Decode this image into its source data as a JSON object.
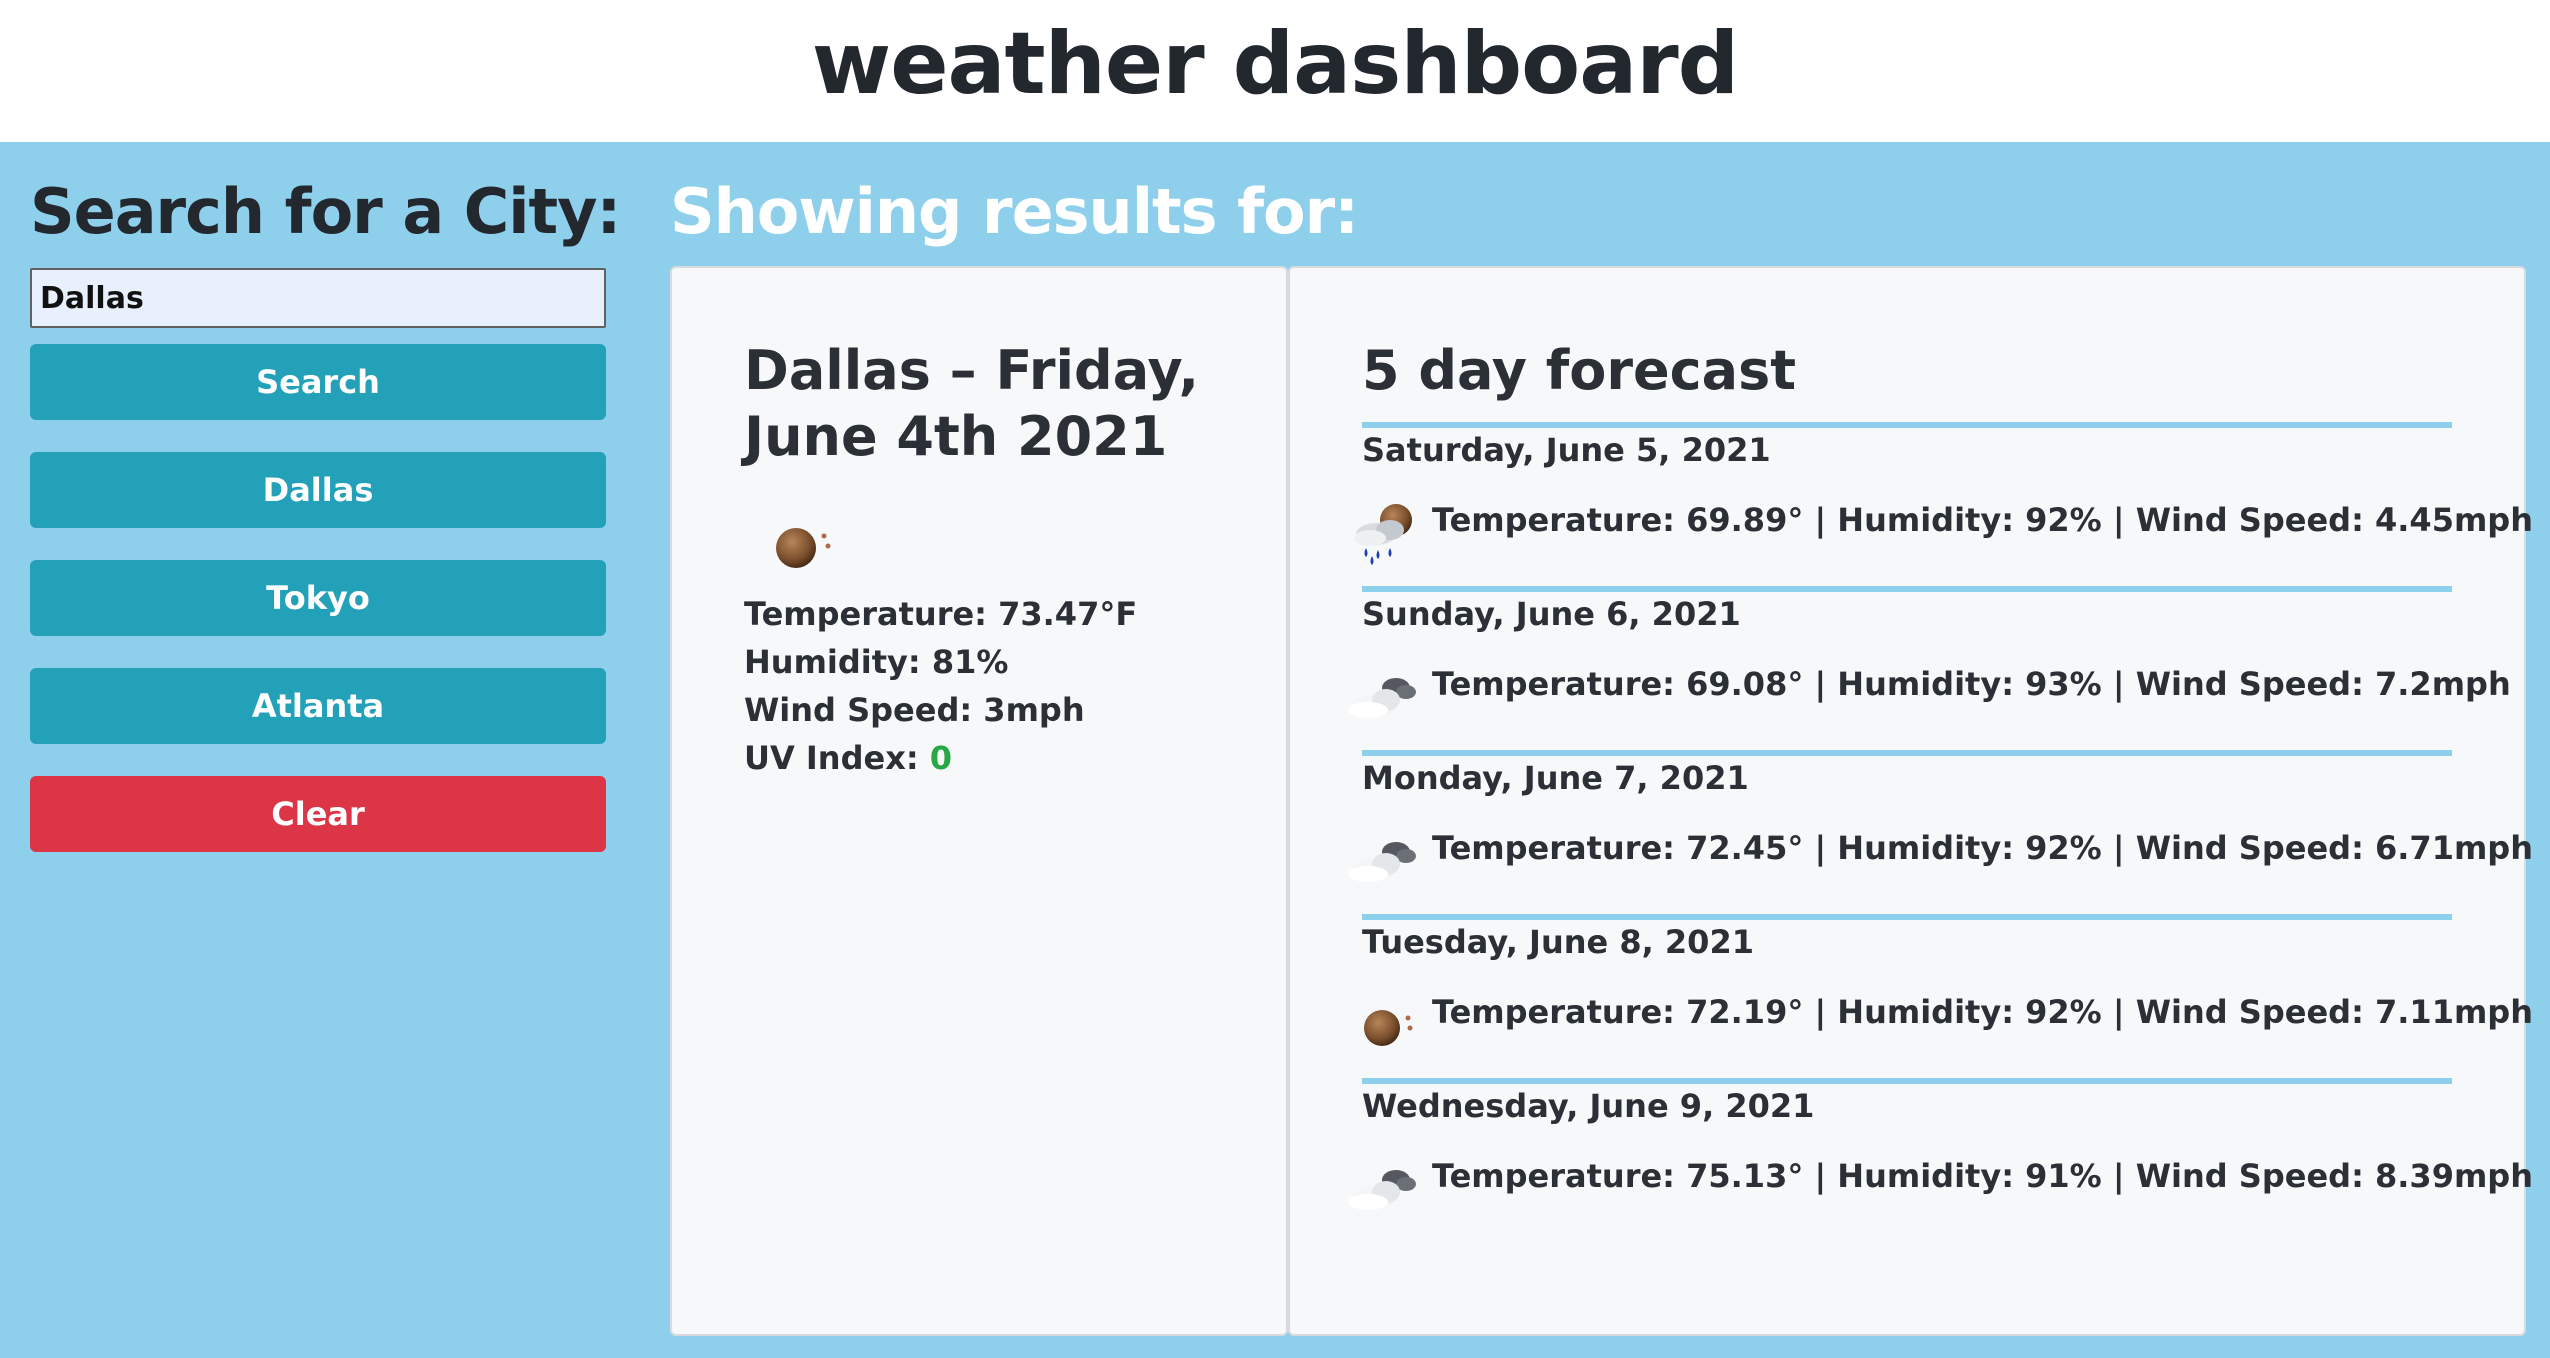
{
  "header": {
    "title": "weather dashboard"
  },
  "sidebar": {
    "heading": "Search for a City:",
    "search_value": "Dallas",
    "search_button": "Search",
    "history": [
      "Dallas",
      "Tokyo",
      "Atlanta"
    ],
    "clear_button": "Clear"
  },
  "results": {
    "heading": "Showing results for:"
  },
  "current": {
    "title": "Dallas – Friday, June 4th 2021",
    "icon": "sun-haze-icon",
    "temperature": "Temperature: 73.47°F",
    "humidity": "Humidity: 81%",
    "wind": "Wind Speed: 3mph",
    "uv_label": "UV Index: ",
    "uv_value": "0"
  },
  "forecast": {
    "title": "5 day forecast",
    "days": [
      {
        "date": "Saturday, June 5, 2021",
        "icon": "rain-cloud-icon",
        "info": "Temperature: 69.89° | Humidity: 92% | Wind Speed: 4.45mph"
      },
      {
        "date": "Sunday, June 6, 2021",
        "icon": "cloud-icon",
        "info": "Temperature: 69.08° | Humidity: 93% | Wind Speed: 7.2mph"
      },
      {
        "date": "Monday, June 7, 2021",
        "icon": "cloud-icon",
        "info": "Temperature: 72.45° | Humidity: 92% | Wind Speed: 6.71mph"
      },
      {
        "date": "Tuesday, June 8, 2021",
        "icon": "sun-haze-icon",
        "info": "Temperature: 72.19° | Humidity: 92% | Wind Speed: 7.11mph"
      },
      {
        "date": "Wednesday, June 9, 2021",
        "icon": "cloud-icon",
        "info": "Temperature: 75.13° | Humidity: 91% | Wind Speed: 8.39mph"
      }
    ]
  },
  "colors": {
    "background": "#8ed0ec",
    "button": "#23a1b8",
    "clear_button": "#dc3545",
    "uv_good": "#28a745"
  }
}
